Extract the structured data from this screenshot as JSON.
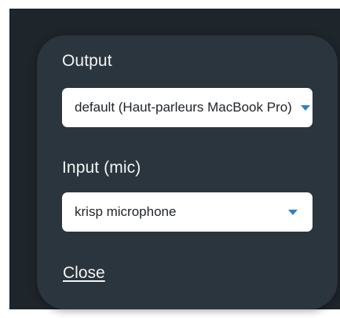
{
  "audio_settings": {
    "output": {
      "label": "Output",
      "selected": "default (Haut-parleurs MacBook Pro)"
    },
    "input": {
      "label": "Input (mic)",
      "selected": "krisp microphone"
    },
    "close_label": "Close"
  },
  "icons": {
    "dropdown": "caret-down-icon"
  },
  "colors": {
    "backdrop": "#1e252b",
    "panel": "#2b353d",
    "text": "#f2f4f5",
    "field_background": "#ffffff",
    "caret_accent": "#2f7fc9"
  }
}
